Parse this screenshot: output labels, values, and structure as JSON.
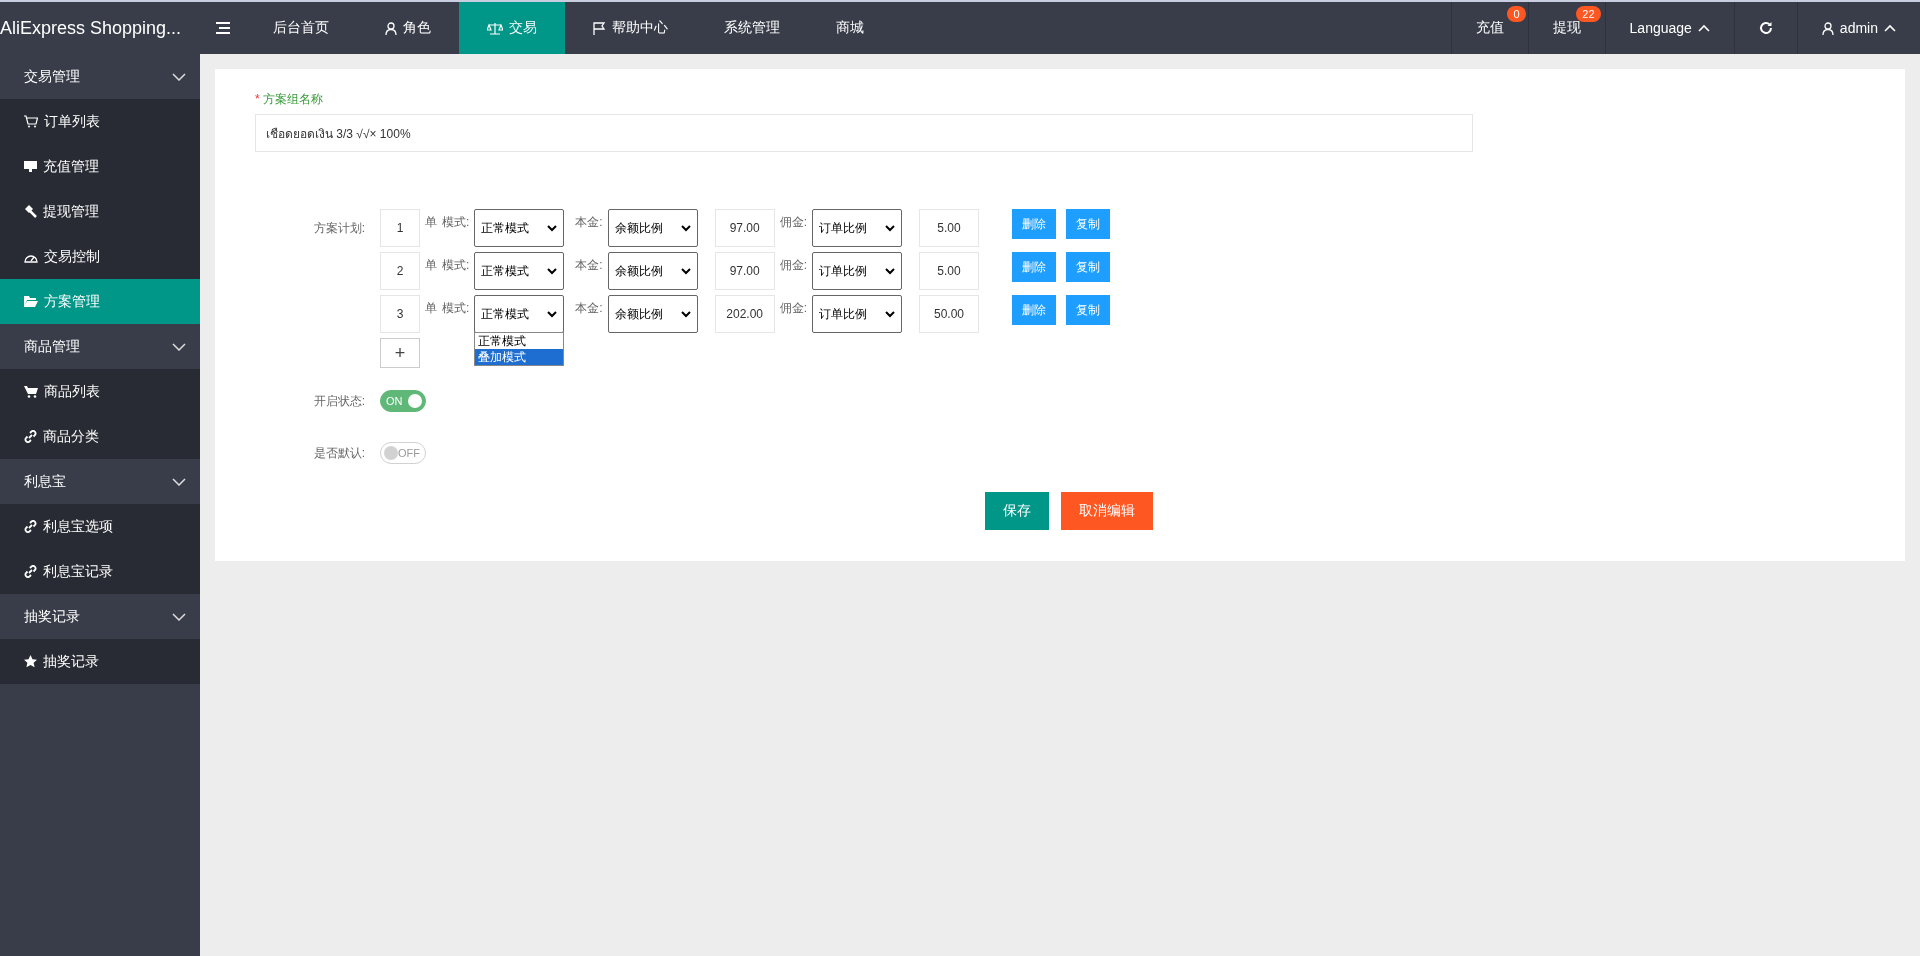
{
  "app": {
    "title": "AliExpress Shopping..."
  },
  "top_menu": [
    {
      "label": "后台首页",
      "selected": false
    },
    {
      "label": "角色",
      "selected": false
    },
    {
      "label": "交易",
      "selected": true
    },
    {
      "label": "帮助中心",
      "selected": false
    },
    {
      "label": "系统管理",
      "selected": false
    },
    {
      "label": "商城",
      "selected": false
    }
  ],
  "top_right": {
    "links": [
      {
        "label": "充值",
        "badge": "0"
      },
      {
        "label": "提现",
        "badge": "22"
      }
    ],
    "language": "Language",
    "user": "admin"
  },
  "sidebar": [
    {
      "label": "交易管理",
      "expanded": true,
      "items": [
        {
          "label": "订单列表",
          "selected": false
        },
        {
          "label": "充值管理",
          "selected": false
        },
        {
          "label": "提现管理",
          "selected": false
        },
        {
          "label": "交易控制",
          "selected": false
        },
        {
          "label": "方案管理",
          "selected": true
        }
      ]
    },
    {
      "label": "商品管理",
      "expanded": true,
      "items": [
        {
          "label": "商品列表",
          "selected": false
        },
        {
          "label": "商品分类",
          "selected": false
        }
      ]
    },
    {
      "label": "利息宝",
      "expanded": true,
      "items": [
        {
          "label": "利息宝选项",
          "selected": false
        },
        {
          "label": "利息宝记录",
          "selected": false
        }
      ]
    },
    {
      "label": "抽奖记录",
      "expanded": true,
      "items": [
        {
          "label": "抽奖记录",
          "selected": false
        }
      ]
    }
  ],
  "form": {
    "required_mark": "*",
    "name_label": "方案组名称",
    "name_value": "เชือดยอดเงิน 3/3 √√× 100%",
    "plan_label": "方案计划:",
    "plans": [
      {
        "count": "1",
        "unit": "单",
        "mode_label": "模式:",
        "mode": "正常模式",
        "principal_label": "本金:",
        "principal_type": "余额比例",
        "principal": "97.00",
        "commission_label": "佣金:",
        "commission_type": "订单比例",
        "commission": "5.00",
        "delete": "删除",
        "copy": "复制"
      },
      {
        "count": "2",
        "unit": "单",
        "mode_label": "模式:",
        "mode": "正常模式",
        "principal_label": "本金:",
        "principal_type": "余额比例",
        "principal": "97.00",
        "commission_label": "佣金:",
        "commission_type": "订单比例",
        "commission": "5.00",
        "delete": "删除",
        "copy": "复制"
      },
      {
        "count": "3",
        "unit": "单",
        "mode_label": "模式:",
        "mode": "正常模式",
        "principal_label": "本金:",
        "principal_type": "余额比例",
        "principal": "202.00",
        "commission_label": "佣金:",
        "commission_type": "订单比例",
        "commission": "50.00",
        "delete": "删除",
        "copy": "复制",
        "mode_options": [
          {
            "label": "正常模式",
            "selected": false
          },
          {
            "label": "叠加模式",
            "selected": true
          }
        ]
      }
    ],
    "add_button": "+",
    "switches": [
      {
        "label": "开启状态:",
        "on": true,
        "text": "ON"
      },
      {
        "label": "是否默认:",
        "on": false,
        "text": "OFF"
      }
    ],
    "save": "保存",
    "cancel": "取消编辑"
  }
}
